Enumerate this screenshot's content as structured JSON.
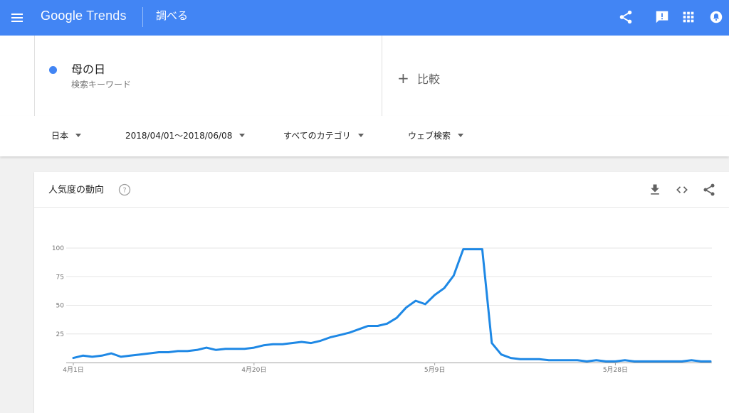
{
  "header": {
    "logo_google": "Google",
    "logo_trends": "Trends",
    "explore_label": "調べる",
    "icons": [
      "menu-icon",
      "share-icon",
      "feedback-icon",
      "apps-icon",
      "notifications-icon"
    ],
    "brand_color": "#4285f4"
  },
  "term": {
    "title": "母の日",
    "subtitle": "検索キーワード",
    "dot_color": "#4285f4"
  },
  "compare": {
    "plus": "+",
    "label": "比較"
  },
  "filters": {
    "region": "日本",
    "date_range": "2018/04/01～2018/06/08",
    "category": "すべてのカテゴリ",
    "property": "ウェブ検索"
  },
  "card": {
    "title": "人気度の動向",
    "help_icon": "help-icon",
    "actions": [
      "download-icon",
      "embed-icon",
      "share-icon"
    ]
  },
  "chart_data": {
    "type": "line",
    "x_start": "2018-04-01",
    "x_end": "2018-06-08",
    "x_tick_labels": [
      "4月1日",
      "4月20日",
      "5月9日",
      "5月28日"
    ],
    "x_tick_index": [
      0,
      19,
      38,
      57
    ],
    "y_ticks": [
      25,
      50,
      75,
      100
    ],
    "ylim": [
      0,
      100
    ],
    "grid": true,
    "line_color": "#1e88e5",
    "values": [
      4,
      6,
      5,
      6,
      8,
      5,
      6,
      7,
      8,
      9,
      9,
      10,
      10,
      11,
      13,
      11,
      12,
      12,
      12,
      13,
      15,
      16,
      16,
      17,
      18,
      17,
      19,
      22,
      24,
      26,
      29,
      32,
      32,
      34,
      39,
      48,
      54,
      51,
      59,
      65,
      76,
      99,
      99,
      99,
      17,
      7,
      4,
      3,
      3,
      3,
      2,
      2,
      2,
      2,
      1,
      2,
      1,
      1,
      2,
      1,
      1,
      1,
      1,
      1,
      1,
      2,
      1,
      1
    ]
  }
}
